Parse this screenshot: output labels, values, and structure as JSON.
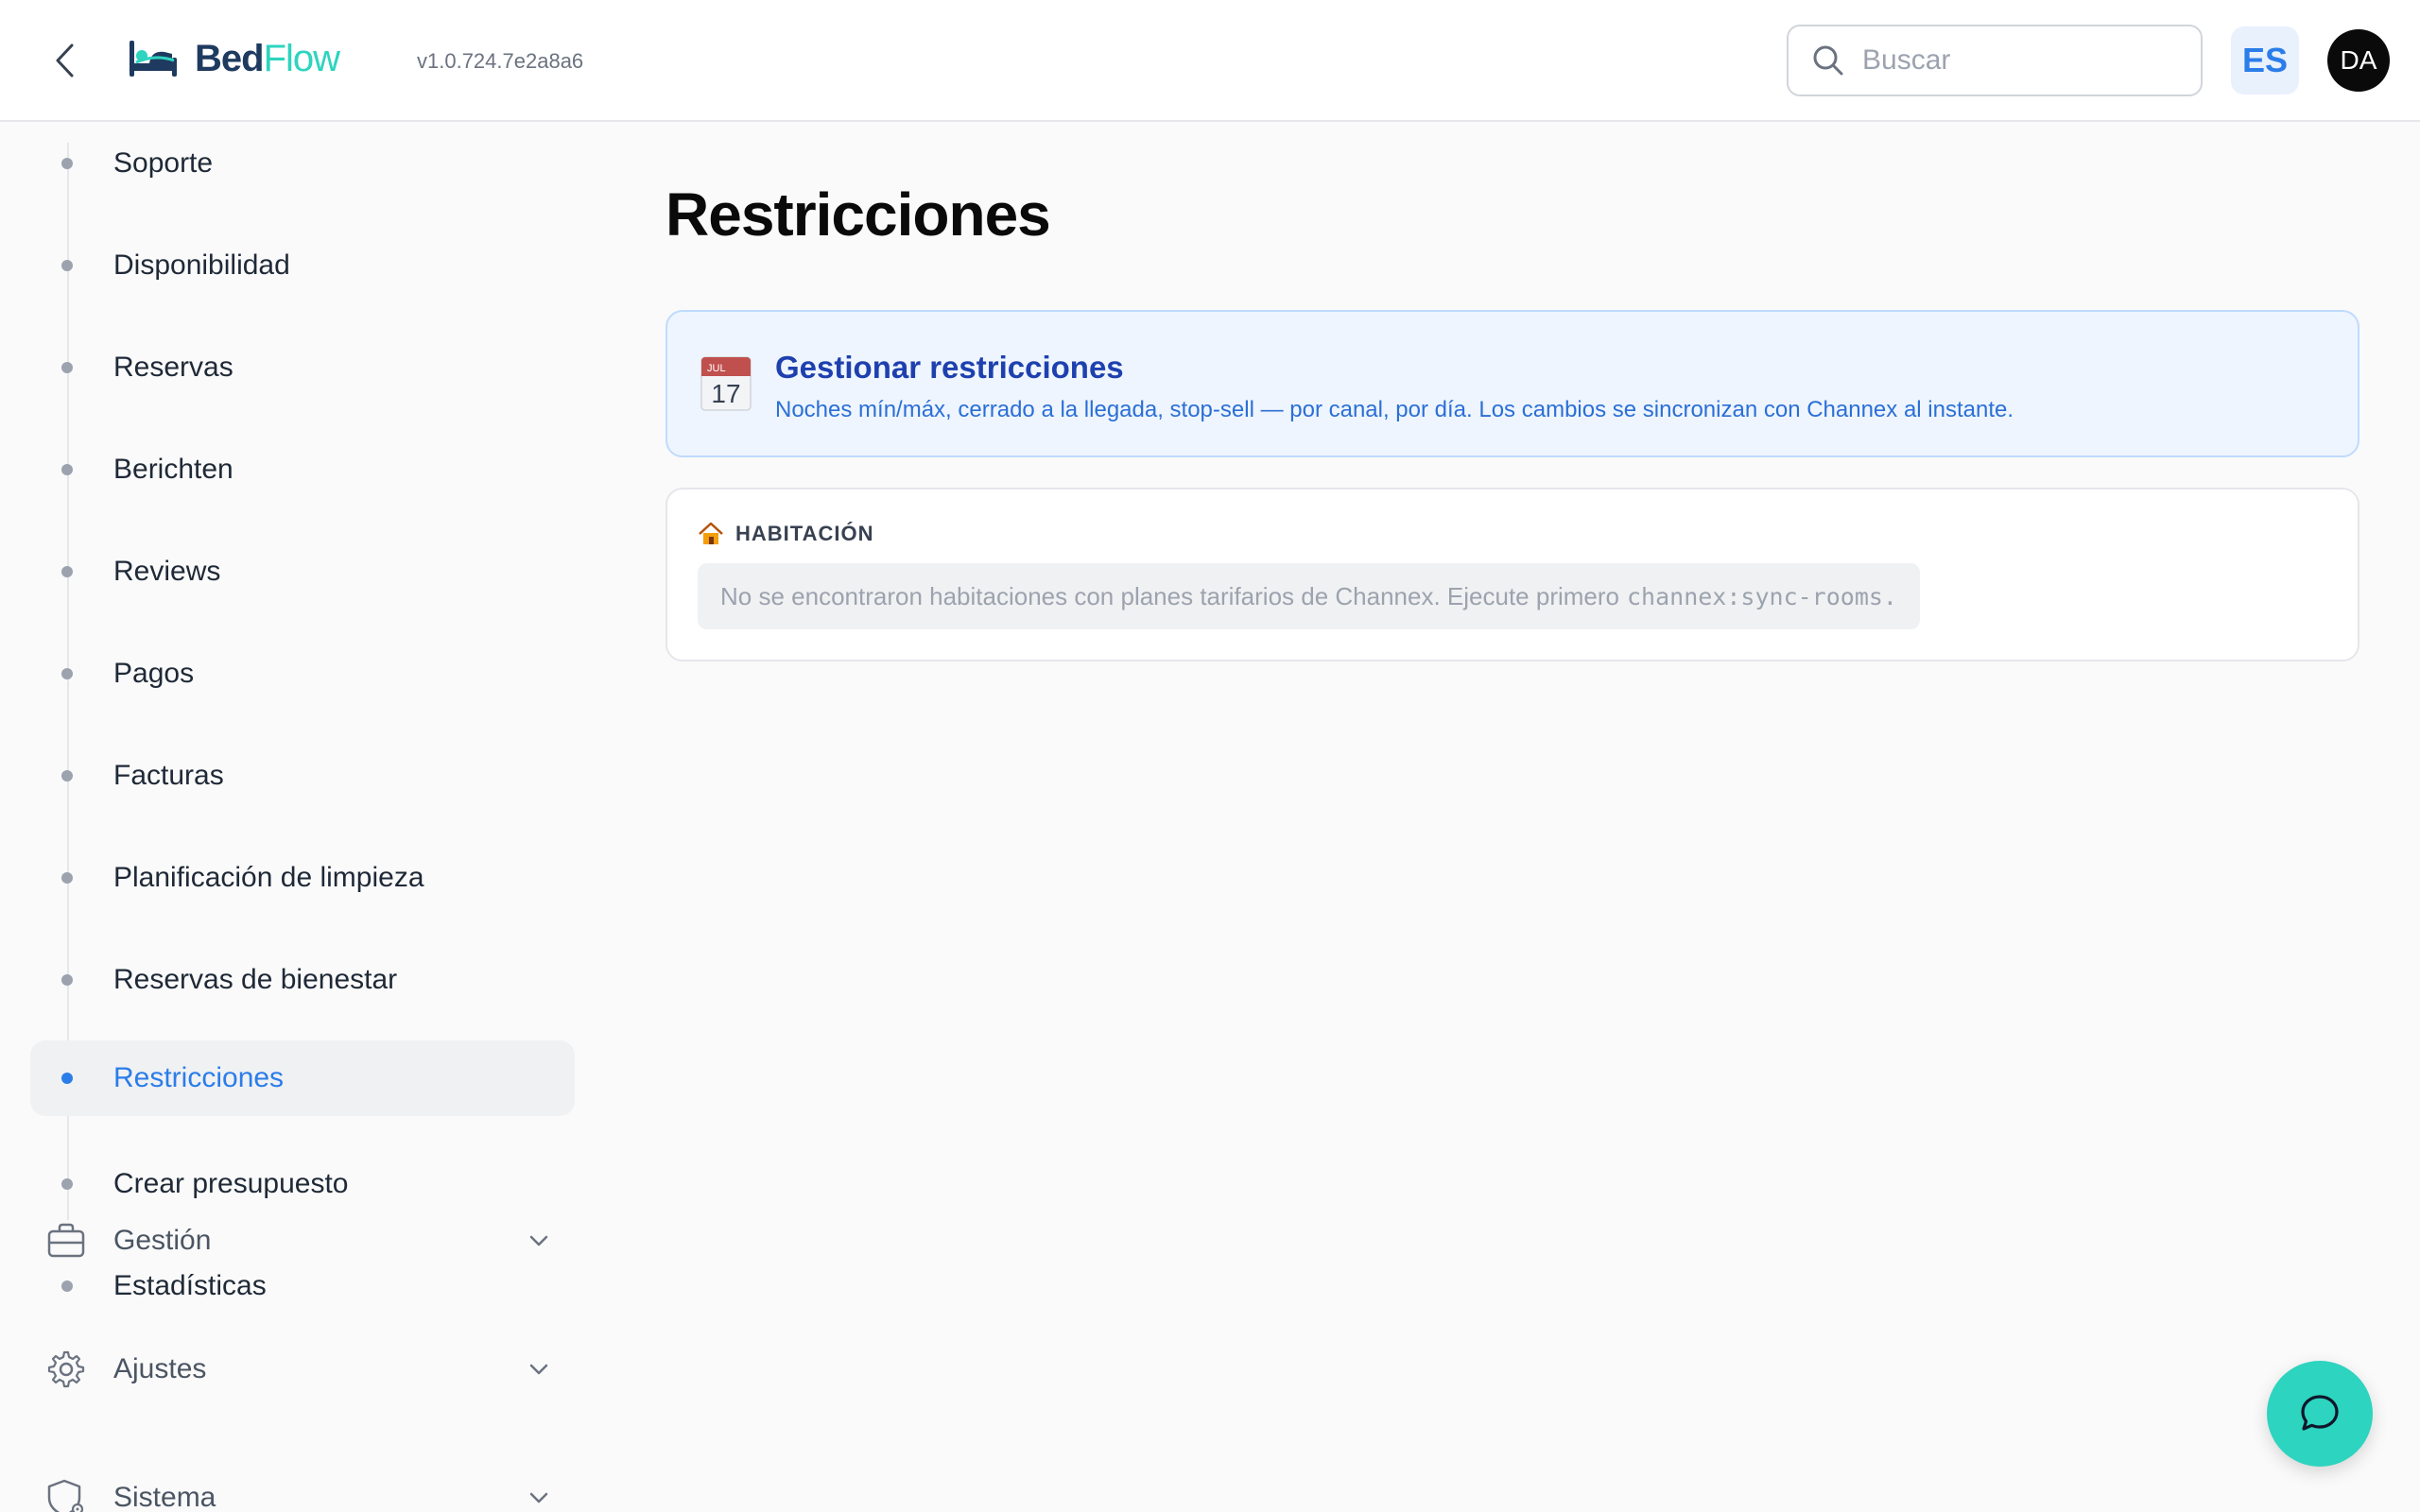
{
  "header": {
    "back_icon": "chevron-left-icon",
    "logo": {
      "part1": "Bed",
      "part2": "Flow"
    },
    "version": "v1.0.724.7e2a8a6",
    "search": {
      "placeholder": "Buscar",
      "value": ""
    },
    "language": "ES",
    "avatar_initials": "DA"
  },
  "sidebar": {
    "items": [
      {
        "label": "Soporte",
        "active": false
      },
      {
        "label": "Disponibilidad",
        "active": false
      },
      {
        "label": "Reservas",
        "active": false
      },
      {
        "label": "Berichten",
        "active": false
      },
      {
        "label": "Reviews",
        "active": false
      },
      {
        "label": "Pagos",
        "active": false
      },
      {
        "label": "Facturas",
        "active": false
      },
      {
        "label": "Planificación de limpieza",
        "active": false
      },
      {
        "label": "Reservas de bienestar",
        "active": false
      },
      {
        "label": "Restricciones",
        "active": true
      },
      {
        "label": "Crear presupuesto",
        "active": false
      },
      {
        "label": "Estadísticas",
        "active": false
      }
    ],
    "groups": [
      {
        "label": "Gestión",
        "icon": "briefcase-icon"
      },
      {
        "label": "Ajustes",
        "icon": "gear-icon"
      },
      {
        "label": "Sistema",
        "icon": "shield-gear-icon"
      }
    ]
  },
  "main": {
    "title": "Restricciones",
    "info_card": {
      "icon": "calendar-icon",
      "icon_month": "JUL",
      "icon_day": "17",
      "title": "Gestionar restricciones",
      "description": "Noches mín/máx, cerrado a la llegada, stop-sell — por canal, por día. Los cambios se sincronizan con Channex al instante."
    },
    "room_card": {
      "icon": "house-icon",
      "label": "HABITACIÓN",
      "empty_text": "No se encontraron habitaciones con planes tarifarios de Channex. Ejecute primero",
      "empty_command": "channex:sync-rooms."
    }
  },
  "chat_button_icon": "chat-bubble-icon",
  "colors": {
    "accent": "#2b7de9",
    "brand_teal": "#2dd4bf",
    "brand_navy": "#1e3a5f",
    "info_bg": "#eef5fe",
    "info_title": "#1e40af"
  }
}
